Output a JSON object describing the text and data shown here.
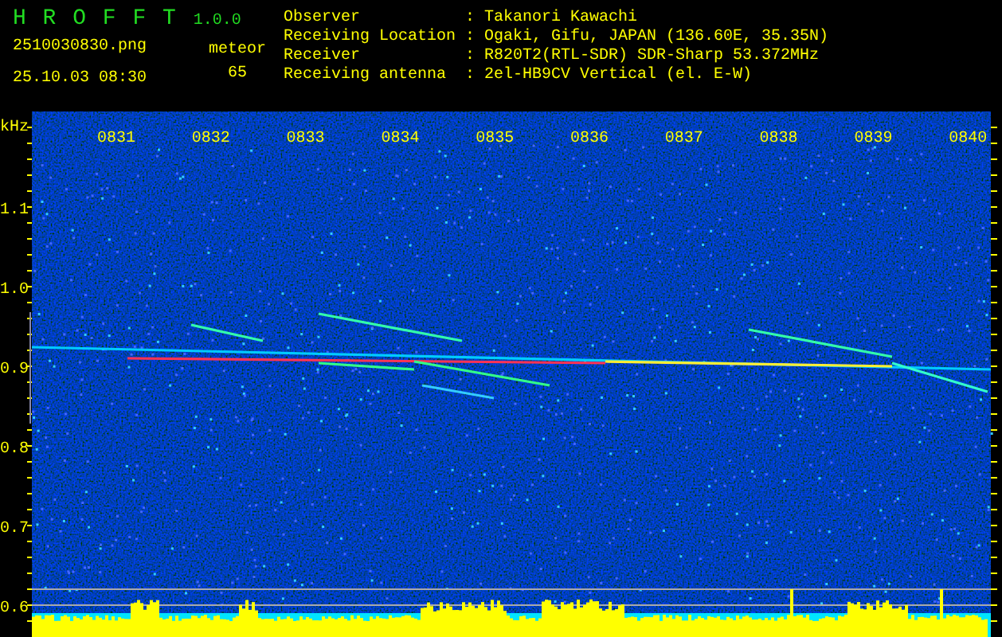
{
  "app": {
    "title": "H R O F F T",
    "version": "1.0.0"
  },
  "file": {
    "name": "2510030830.png",
    "datetime": "25.10.03 08:30"
  },
  "count": {
    "label": "meteor",
    "value": "65"
  },
  "info": [
    {
      "label": "Observer",
      "colon": ":",
      "value": "Takanori Kawachi"
    },
    {
      "label": "Receiving Location",
      "colon": ":",
      "value": "Ogaki, Gifu, JAPAN (136.60E, 35.35N)"
    },
    {
      "label": "Receiver",
      "colon": ":",
      "value": "R820T2(RTL-SDR) SDR-Sharp 53.372MHz"
    },
    {
      "label": "Receiving antenna",
      "colon": ":",
      "value": "2el-HB9CV Vertical (el. E-W)"
    }
  ],
  "spectrogram": {
    "unit": "kHz",
    "time_labels": [
      "0831",
      "0832",
      "0833",
      "0834",
      "0835",
      "0836",
      "0837",
      "0838",
      "0839",
      "0840"
    ],
    "freq_labels": [
      "1.1",
      "1.0",
      "0.9",
      "0.8",
      "0.7",
      "0.6"
    ]
  }
}
